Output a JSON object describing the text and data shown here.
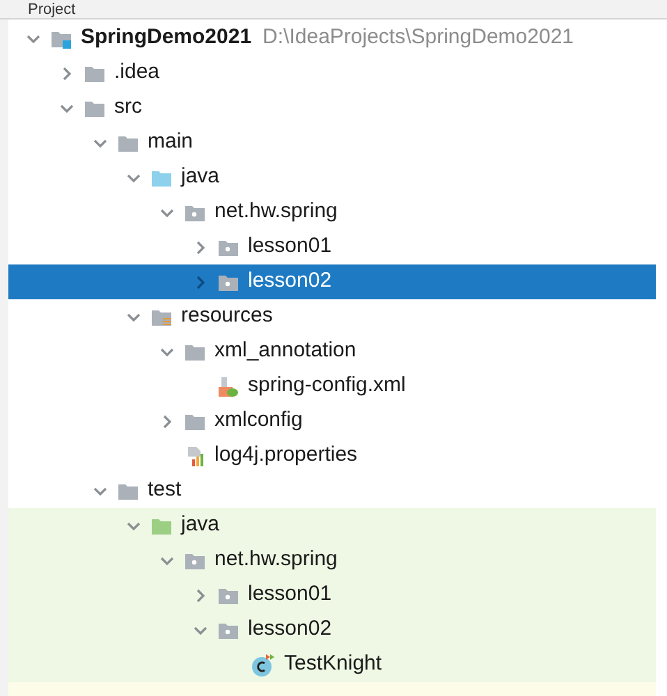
{
  "panel": {
    "title": "Project"
  },
  "tree": [
    {
      "name": "SpringDemo2021",
      "path": "D:\\IdeaProjects\\SpringDemo2021",
      "kind": "project",
      "expanded": true,
      "selected": false,
      "children": [
        {
          "name": ".idea",
          "kind": "folder",
          "expanded": false,
          "selected": false
        },
        {
          "name": "src",
          "kind": "folder",
          "expanded": true,
          "selected": false,
          "children": [
            {
              "name": "main",
              "kind": "folder",
              "expanded": true,
              "selected": false,
              "children": [
                {
                  "name": "java",
                  "kind": "source",
                  "expanded": true,
                  "selected": false,
                  "children": [
                    {
                      "name": "net.hw.spring",
                      "kind": "package",
                      "expanded": true,
                      "selected": false,
                      "children": [
                        {
                          "name": "lesson01",
                          "kind": "package",
                          "expanded": false,
                          "selected": false
                        },
                        {
                          "name": "lesson02",
                          "kind": "package",
                          "expanded": false,
                          "selected": true
                        }
                      ]
                    }
                  ]
                },
                {
                  "name": "resources",
                  "kind": "resources",
                  "expanded": true,
                  "selected": false,
                  "children": [
                    {
                      "name": "xml_annotation",
                      "kind": "folder",
                      "expanded": true,
                      "selected": false,
                      "children": [
                        {
                          "name": "spring-config.xml",
                          "kind": "xml",
                          "selected": false
                        }
                      ]
                    },
                    {
                      "name": "xmlconfig",
                      "kind": "folder",
                      "expanded": false,
                      "selected": false
                    },
                    {
                      "name": "log4j.properties",
                      "kind": "properties",
                      "selected": false
                    }
                  ]
                }
              ]
            },
            {
              "name": "test",
              "kind": "folder",
              "expanded": true,
              "selected": false,
              "children": [
                {
                  "name": "java",
                  "kind": "test",
                  "expanded": true,
                  "selected": false,
                  "children": [
                    {
                      "name": "net.hw.spring",
                      "kind": "package",
                      "expanded": true,
                      "selected": false,
                      "children": [
                        {
                          "name": "lesson01",
                          "kind": "package",
                          "expanded": false,
                          "selected": false
                        },
                        {
                          "name": "lesson02",
                          "kind": "package",
                          "expanded": true,
                          "selected": false,
                          "children": [
                            {
                              "name": "TestKnight",
                              "kind": "class",
                              "selected": false
                            }
                          ]
                        }
                      ]
                    }
                  ]
                }
              ]
            }
          ]
        }
      ]
    }
  ]
}
